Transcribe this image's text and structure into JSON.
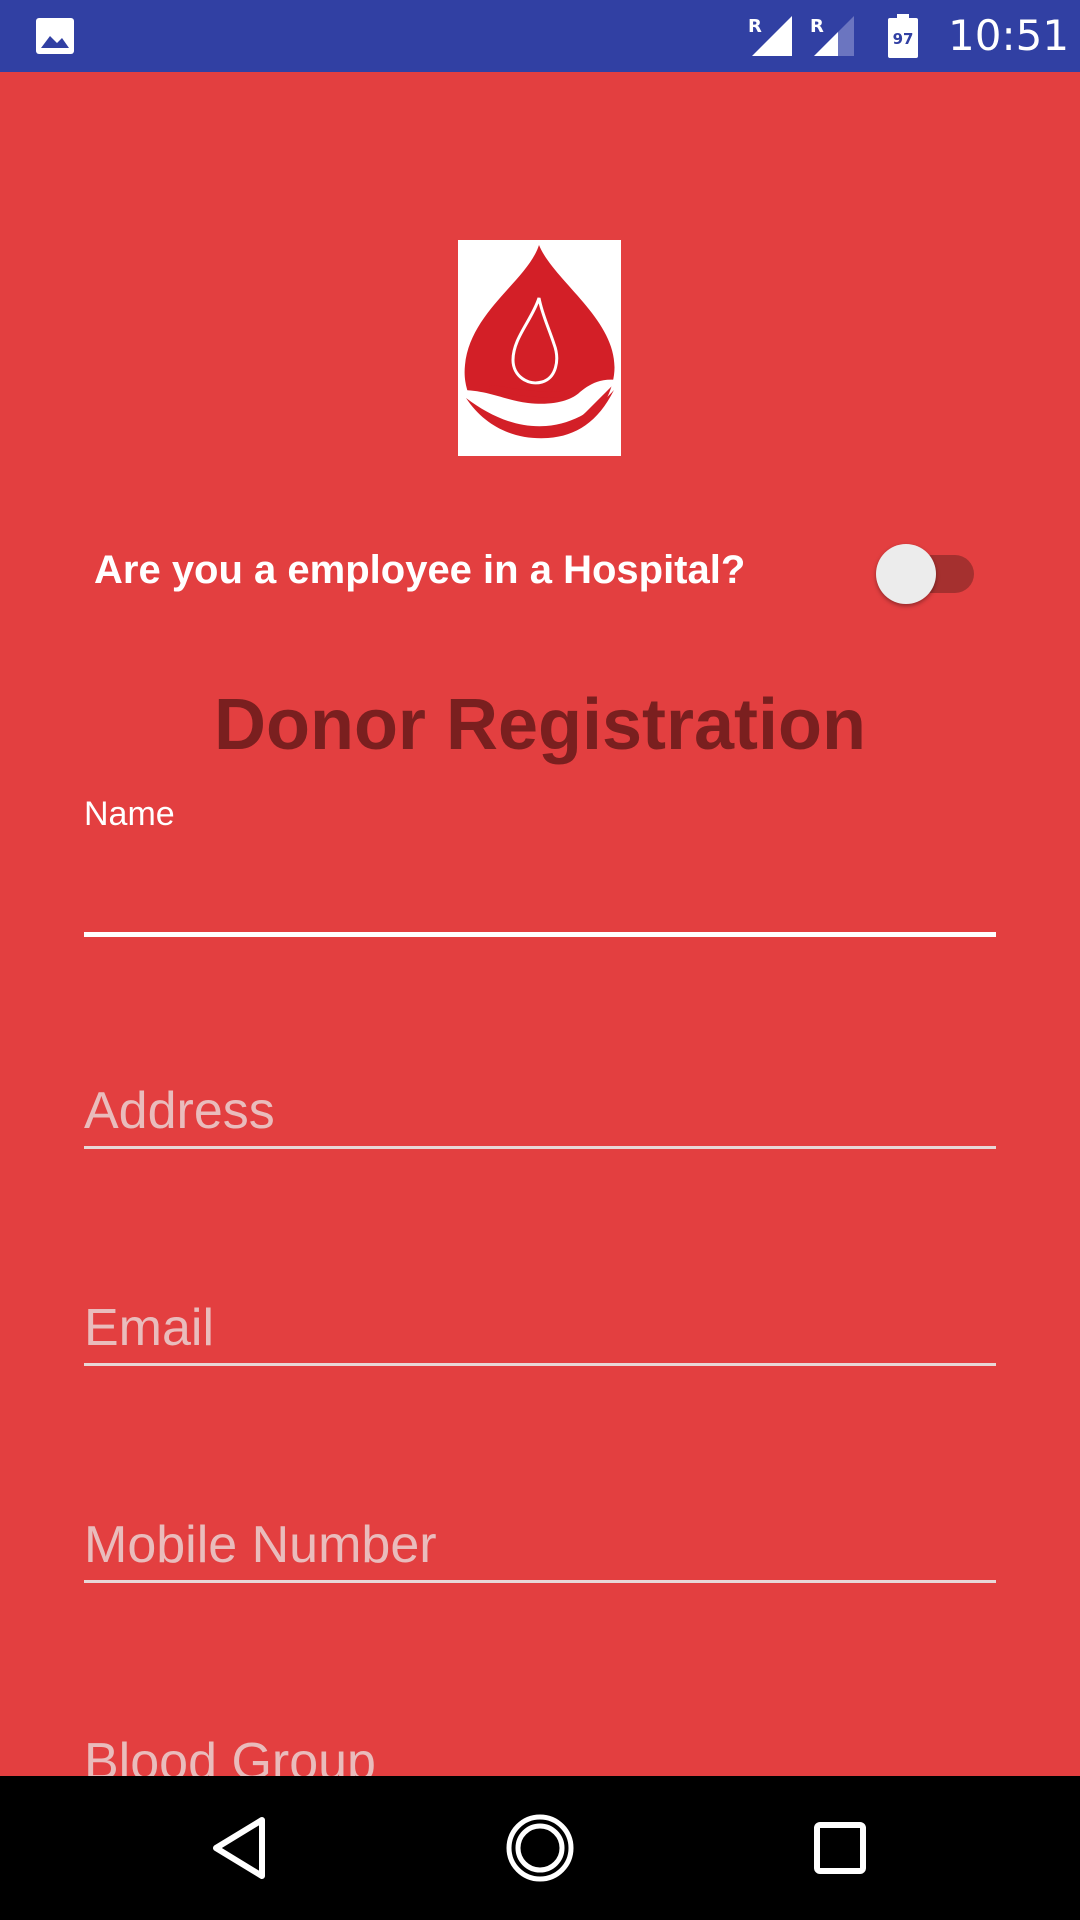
{
  "status_bar": {
    "time": "10:51",
    "battery_level": "97",
    "signal_1_roaming": "R",
    "signal_2_roaming": "R",
    "icons": [
      "gallery-icon",
      "signal-icon",
      "signal-icon",
      "battery-icon"
    ]
  },
  "toggle": {
    "label": "Are you a employee in a Hospital?",
    "on": false
  },
  "page_title": "Donor Registration",
  "form": {
    "name": {
      "label": "Name",
      "value": ""
    },
    "address": {
      "placeholder": "Address"
    },
    "email": {
      "placeholder": "Email"
    },
    "mobile": {
      "placeholder": "Mobile Number"
    },
    "blood_group": {
      "placeholder": "Blood Group"
    }
  },
  "nav_bar": {
    "icons": [
      "back-icon",
      "home-icon",
      "recents-icon"
    ]
  },
  "colors": {
    "background": "#e33f40",
    "status_bar": "#3140a3",
    "title": "#7a1f1f",
    "logo_red": "#d31f27"
  }
}
